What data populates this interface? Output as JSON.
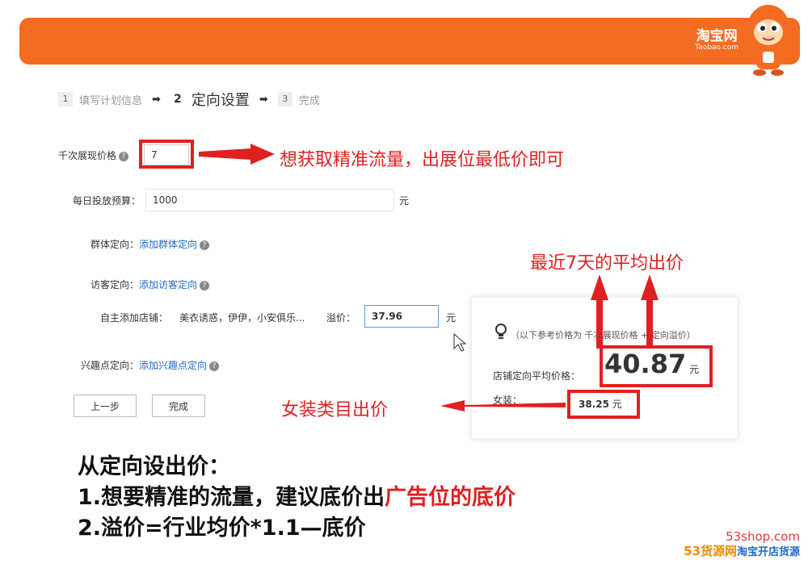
{
  "header": {
    "logo_cn": "淘宝网",
    "logo_en": "Taobao.com",
    "brand_color": "#f36c21"
  },
  "steps": [
    {
      "num": "1",
      "label": "填写计划信息"
    },
    {
      "num": "2",
      "label": "定向设置"
    },
    {
      "num": "3",
      "label": "完成"
    }
  ],
  "form": {
    "cpm_label": "千次展现价格",
    "cpm_value": "7",
    "budget_label": "每日投放预算：",
    "budget_value": "1000",
    "budget_unit": "元",
    "group_label": "群体定向：",
    "group_link": "添加群体定向",
    "visitor_label": "访客定向：",
    "visitor_link": "添加访客定向",
    "shops_label": "自主添加店铺：",
    "shops_value": "美衣诱惑，伊伊，小安俱乐...",
    "premium_label": "溢价：",
    "premium_value": "37.96",
    "premium_unit": "元",
    "interest_label": "兴趣点定向：",
    "interest_link": "添加兴趣点定向",
    "prev_button": "上一步",
    "finish_button": "完成"
  },
  "reference": {
    "note": "（以下参考价格为 千次展现价格 + 定向溢价）",
    "shop_avg_label": "店铺定向平均价格：",
    "shop_avg_value": "40.87",
    "shop_avg_unit": "元",
    "women_label": "女装：",
    "women_value": "38.25",
    "women_unit": "元"
  },
  "annotations": {
    "lowest_price": "想获取精准流量，出展位最低价即可",
    "avg_7days": "最近7天的平均出价",
    "women_category": "女装类目出价",
    "accent_color": "#e02020"
  },
  "summary": {
    "line1": "从定向设出价：",
    "line2_prefix": "1.想要精准的流量，建议底价出",
    "line2_highlight": "广告位的底价",
    "line3": "2.溢价=行业均价*1.1—底价"
  },
  "watermark": {
    "domain": "53shop.com",
    "brand": "53货源网",
    "slogan": "淘宝开店货源"
  }
}
